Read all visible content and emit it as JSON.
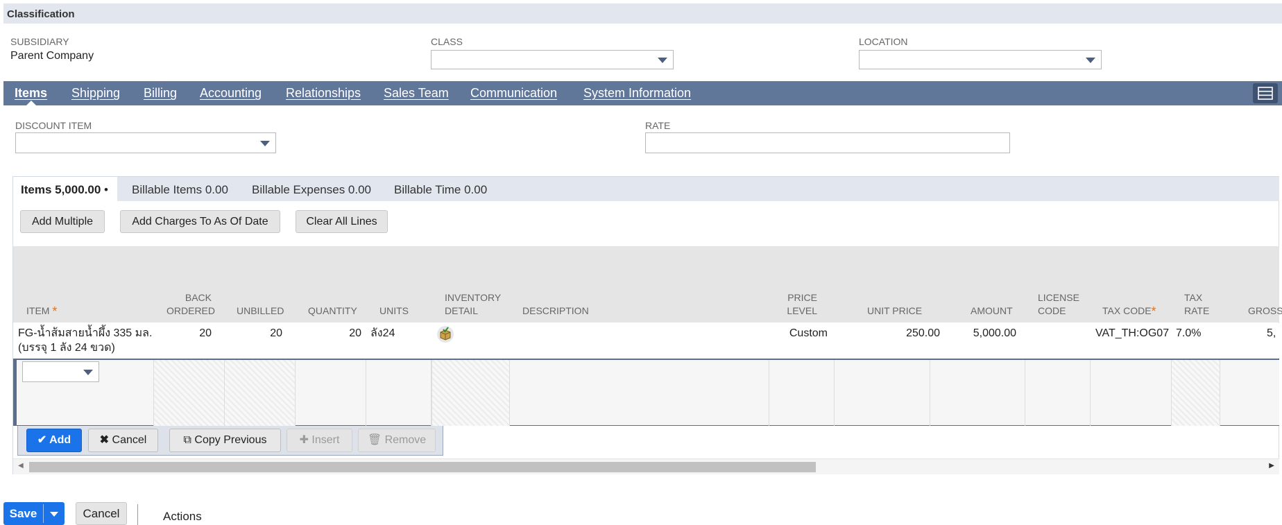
{
  "classification": {
    "header": "Classification",
    "subsidiary_label": "SUBSIDIARY",
    "subsidiary_value": "Parent Company",
    "class_label": "CLASS",
    "location_label": "LOCATION"
  },
  "tabs": [
    "Items",
    "Shipping",
    "Billing",
    "Accounting",
    "Relationships",
    "Sales Team",
    "Communication",
    "System Information"
  ],
  "discount": {
    "discount_item_label": "DISCOUNT ITEM",
    "rate_label": "RATE"
  },
  "subtabs": {
    "items": "Items 5,000.00",
    "items_dot": "•",
    "billable_items": "Billable Items 0.00",
    "billable_expenses": "Billable Expenses 0.00",
    "billable_time": "Billable Time 0.00"
  },
  "buttons": {
    "add_multiple": "Add Multiple",
    "add_charges": "Add Charges To As Of Date",
    "clear_all": "Clear All Lines"
  },
  "columns": {
    "item": "ITEM",
    "back_ordered_1": "BACK",
    "back_ordered_2": "ORDERED",
    "unbilled": "UNBILLED",
    "quantity": "QUANTITY",
    "units": "UNITS",
    "inventory_1": "INVENTORY",
    "inventory_2": "DETAIL",
    "description": "DESCRIPTION",
    "price_level_1": "PRICE",
    "price_level_2": "LEVEL",
    "unit_price": "UNIT PRICE",
    "amount": "AMOUNT",
    "license_1": "LICENSE",
    "license_2": "CODE",
    "tax_code": "TAX CODE",
    "tax_rate_1": "TAX",
    "tax_rate_2": "RATE",
    "gross": "GROSS"
  },
  "row": {
    "item_line1": "FG-น้ำส้มสายน้ำผึ้ง 335 มล.",
    "item_line2": "(บรรจุ 1 ลัง 24 ขวด)",
    "back_ordered": "20",
    "unbilled": "20",
    "quantity": "20",
    "units": "ลัง24",
    "price_level": "Custom",
    "unit_price": "250.00",
    "amount": "5,000.00",
    "tax_code": "VAT_TH:OG07",
    "tax_rate": "7.0%",
    "gross": "5,"
  },
  "line_actions": {
    "add": "Add",
    "cancel": "Cancel",
    "copy_previous": "Copy Previous",
    "insert": "Insert",
    "remove": "Remove"
  },
  "footer": {
    "save": "Save",
    "cancel": "Cancel",
    "actions": "Actions"
  },
  "colors": {
    "tabbar": "#607799",
    "primary": "#1a73e8",
    "required": "#e3731b"
  }
}
